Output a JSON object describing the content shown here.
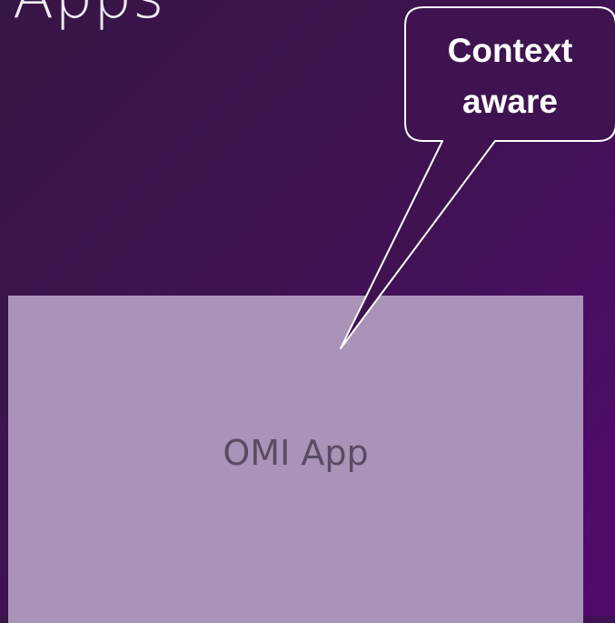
{
  "slide": {
    "title": "Apps"
  },
  "app_box": {
    "label": "OMI App",
    "fill_color": "#aa93b9"
  },
  "callout": {
    "line1": "Context",
    "line2": "aware",
    "fill_color": "#3f1350",
    "border_color": "#ffffff"
  },
  "colors": {
    "background_start": "#371545",
    "background_end": "#520a6b"
  }
}
